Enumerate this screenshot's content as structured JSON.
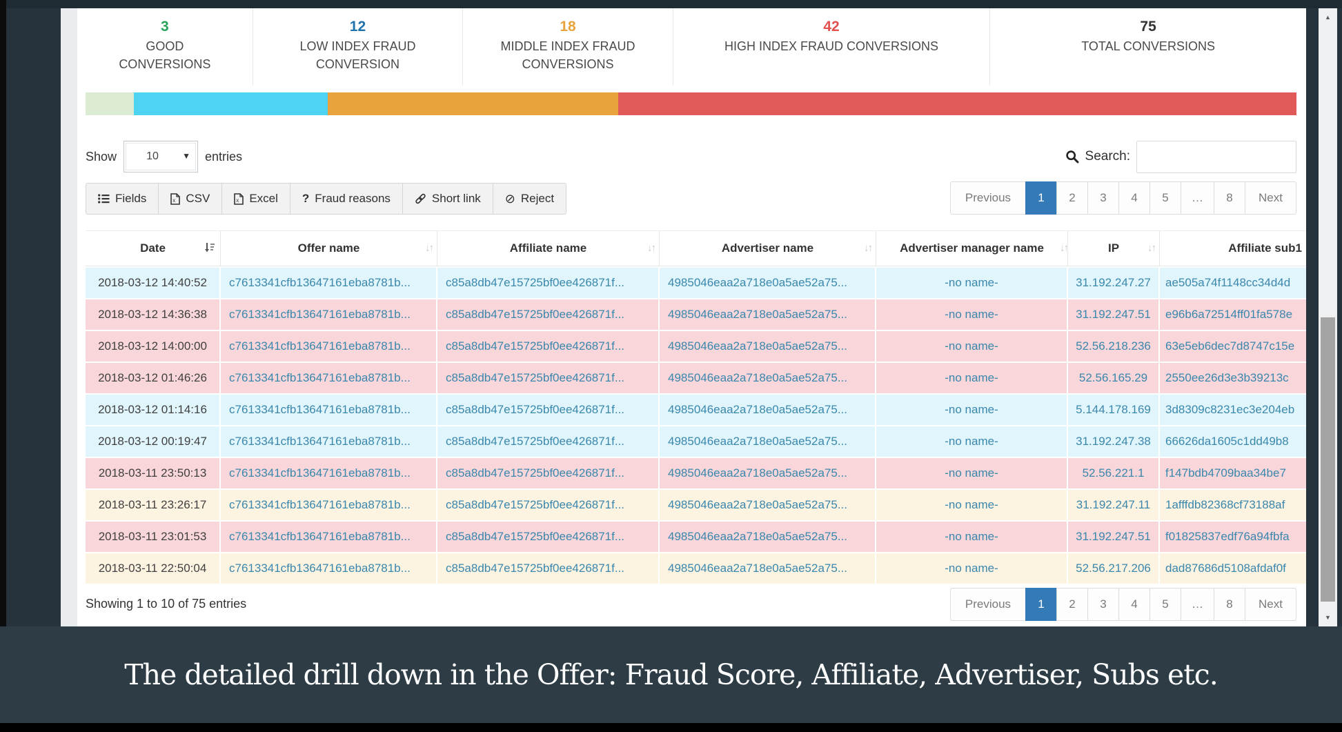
{
  "stats": {
    "items": [
      {
        "value": "3",
        "label": "GOOD CONVERSIONS",
        "color": "#27a35c"
      },
      {
        "value": "12",
        "label": "LOW INDEX FRAUD CONVERSION",
        "color": "#1d72ad"
      },
      {
        "value": "18",
        "label": "MIDDLE INDEX FRAUD CONVERSIONS",
        "color": "#e8a33d"
      },
      {
        "value": "42",
        "label": "HIGH INDEX FRAUD CONVERSIONS",
        "color": "#e25050"
      },
      {
        "value": "75",
        "label": "TOTAL CONVERSIONS",
        "color": "#333333"
      }
    ]
  },
  "score_bar": {
    "segments": [
      {
        "name": "good",
        "count": 3,
        "pct": 4,
        "color": "#dcecd2"
      },
      {
        "name": "low-fraud",
        "count": 12,
        "pct": 16,
        "color": "#4ed3f3"
      },
      {
        "name": "middle-fraud",
        "count": 18,
        "pct": 24,
        "color": "#e8a33c"
      },
      {
        "name": "high-fraud",
        "count": 42,
        "pct": 56,
        "color": "#e05a5a"
      }
    ]
  },
  "controls": {
    "show_label": "Show",
    "page_size": "10",
    "entries_label": "entries",
    "search_label": "Search:",
    "search_value": ""
  },
  "toolbar": {
    "buttons": [
      {
        "icon": "list-icon",
        "label": "Fields"
      },
      {
        "icon": "file-csv-icon",
        "label": "CSV"
      },
      {
        "icon": "file-excel-icon",
        "label": "Excel"
      },
      {
        "icon": "question-icon",
        "label": "Fraud reasons"
      },
      {
        "icon": "link-icon",
        "label": "Short link"
      },
      {
        "icon": "ban-icon",
        "label": "Reject"
      }
    ]
  },
  "pagination": {
    "previous": "Previous",
    "next": "Next",
    "active": "1",
    "pages": [
      {
        "label": "1",
        "active": true
      },
      {
        "label": "2",
        "active": false
      },
      {
        "label": "3",
        "active": false
      },
      {
        "label": "4",
        "active": false
      },
      {
        "label": "5",
        "active": false
      },
      {
        "label": "…",
        "active": false
      },
      {
        "label": "8",
        "active": false
      }
    ],
    "active_color": "#337ab7"
  },
  "table": {
    "columns": [
      {
        "label": "Date",
        "sort": "desc"
      },
      {
        "label": "Offer name",
        "sort": "unsorted"
      },
      {
        "label": "Affiliate name",
        "sort": "unsorted"
      },
      {
        "label": "Advertiser name",
        "sort": "unsorted"
      },
      {
        "label": "Advertiser manager name",
        "sort": "unsorted"
      },
      {
        "label": "IP",
        "sort": "unsorted"
      },
      {
        "label": "Affiliate sub1",
        "sort": "none"
      }
    ],
    "rows": [
      {
        "tone": "cyan",
        "date": "2018-03-12 14:40:52",
        "offer": "c7613341cfb13647161eba8781b...",
        "affiliate": "c85a8db47e15725bf0ee426871f...",
        "advertiser": "4985046eaa2a718e0a5ae52a75...",
        "manager": "-no name-",
        "ip": "31.192.247.27",
        "sub1": "ae505a74f1148cc34d4d"
      },
      {
        "tone": "pink",
        "date": "2018-03-12 14:36:38",
        "offer": "c7613341cfb13647161eba8781b...",
        "affiliate": "c85a8db47e15725bf0ee426871f...",
        "advertiser": "4985046eaa2a718e0a5ae52a75...",
        "manager": "-no name-",
        "ip": "31.192.247.51",
        "sub1": "e96b6a72514ff01fa578e"
      },
      {
        "tone": "pink",
        "date": "2018-03-12 14:00:00",
        "offer": "c7613341cfb13647161eba8781b...",
        "affiliate": "c85a8db47e15725bf0ee426871f...",
        "advertiser": "4985046eaa2a718e0a5ae52a75...",
        "manager": "-no name-",
        "ip": "52.56.218.236",
        "sub1": "63e5eb6dec7d8747c15e"
      },
      {
        "tone": "pink",
        "date": "2018-03-12 01:46:26",
        "offer": "c7613341cfb13647161eba8781b...",
        "affiliate": "c85a8db47e15725bf0ee426871f...",
        "advertiser": "4985046eaa2a718e0a5ae52a75...",
        "manager": "-no name-",
        "ip": "52.56.165.29",
        "sub1": "2550ee26d3e3b39213c"
      },
      {
        "tone": "cyan",
        "date": "2018-03-12 01:14:16",
        "offer": "c7613341cfb13647161eba8781b...",
        "affiliate": "c85a8db47e15725bf0ee426871f...",
        "advertiser": "4985046eaa2a718e0a5ae52a75...",
        "manager": "-no name-",
        "ip": "5.144.178.169",
        "sub1": "3d8309c8231ec3e204eb"
      },
      {
        "tone": "cyan",
        "date": "2018-03-12 00:19:47",
        "offer": "c7613341cfb13647161eba8781b...",
        "affiliate": "c85a8db47e15725bf0ee426871f...",
        "advertiser": "4985046eaa2a718e0a5ae52a75...",
        "manager": "-no name-",
        "ip": "31.192.247.38",
        "sub1": "66626da1605c1dd49b8"
      },
      {
        "tone": "pink",
        "date": "2018-03-11 23:50:13",
        "offer": "c7613341cfb13647161eba8781b...",
        "affiliate": "c85a8db47e15725bf0ee426871f...",
        "advertiser": "4985046eaa2a718e0a5ae52a75...",
        "manager": "-no name-",
        "ip": "52.56.221.1",
        "sub1": "f147bdb4709baa34be7"
      },
      {
        "tone": "cream",
        "date": "2018-03-11 23:26:17",
        "offer": "c7613341cfb13647161eba8781b...",
        "affiliate": "c85a8db47e15725bf0ee426871f...",
        "advertiser": "4985046eaa2a718e0a5ae52a75...",
        "manager": "-no name-",
        "ip": "31.192.247.11",
        "sub1": "1afffdb82368cf73188af"
      },
      {
        "tone": "pink",
        "date": "2018-03-11 23:01:53",
        "offer": "c7613341cfb13647161eba8781b...",
        "affiliate": "c85a8db47e15725bf0ee426871f...",
        "advertiser": "4985046eaa2a718e0a5ae52a75...",
        "manager": "-no name-",
        "ip": "31.192.247.51",
        "sub1": "f01825837edf76a94fbfa"
      },
      {
        "tone": "cream",
        "date": "2018-03-11 22:50:04",
        "offer": "c7613341cfb13647161eba8781b...",
        "affiliate": "c85a8db47e15725bf0ee426871f...",
        "advertiser": "4985046eaa2a718e0a5ae52a75...",
        "manager": "-no name-",
        "ip": "52.56.217.206",
        "sub1": "dad87686d5108afdaf0f"
      }
    ],
    "row_tone_colors": {
      "cyan": "#e1f6fc",
      "pink": "#f8d6d9",
      "cream": "#fdf3e1"
    },
    "link_color": "#3a87ad"
  },
  "footer": {
    "summary": "Showing 1 to 10 of 75 entries"
  },
  "caption": {
    "text": "The detailed drill down in the Offer: Fraud Score, Affiliate, Advertiser, Subs etc."
  }
}
